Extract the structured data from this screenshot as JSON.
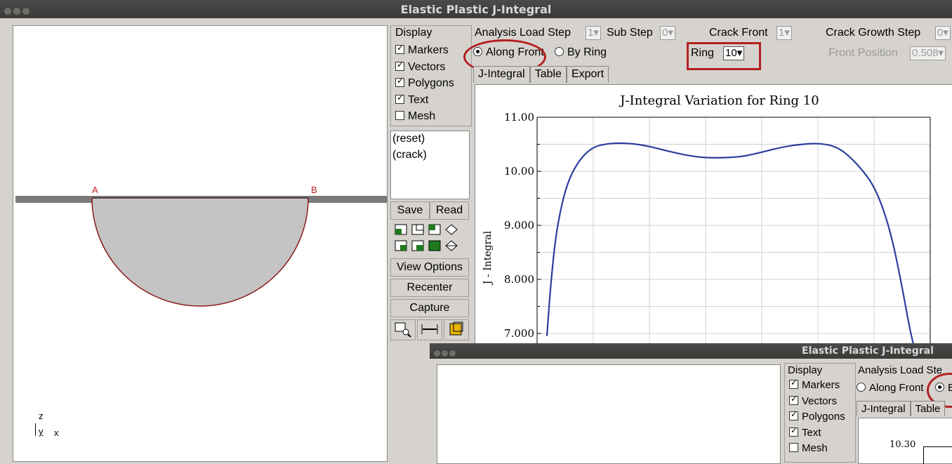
{
  "window": {
    "title": "Elastic Plastic J-Integral"
  },
  "display": {
    "heading": "Display",
    "checkboxes": [
      {
        "label": "Markers",
        "checked": true
      },
      {
        "label": "Vectors",
        "checked": true
      },
      {
        "label": "Polygons",
        "checked": true
      },
      {
        "label": "Text",
        "checked": true
      },
      {
        "label": "Mesh",
        "checked": false
      }
    ],
    "list_items": [
      "(reset)",
      "(crack)"
    ],
    "save_label": "Save",
    "read_label": "Read",
    "view_options_label": "View Options",
    "recenter_label": "Recenter",
    "capture_label": "Capture"
  },
  "viewport": {
    "marker_a": "A",
    "marker_b": "B",
    "axis_z": "z",
    "axis_y": "y",
    "axis_x": "x"
  },
  "controls": {
    "analysis_load_step_label": "Analysis Load Step",
    "analysis_load_step_value": "1",
    "sub_step_label": "Sub Step",
    "sub_step_value": "0",
    "crack_front_label": "Crack Front",
    "crack_front_value": "1",
    "crack_growth_step_label": "Crack Growth Step",
    "crack_growth_step_value": "0",
    "along_front_label": "Along Front",
    "by_ring_label": "By Ring",
    "selected_mode": "Along Front",
    "ring_label": "Ring",
    "ring_value": "10",
    "front_position_label": "Front Position",
    "front_position_value": "0.508"
  },
  "tabs": [
    "J-Integral",
    "Table",
    "Export"
  ],
  "colors": {
    "curve": "#2b3ea0",
    "annotation": "#b41f1f"
  },
  "chart_data": {
    "type": "line",
    "title": "J-Integral Variation for Ring 10",
    "ylabel": "J - Integral",
    "xlabel": "",
    "yticks": [
      "11.00",
      "10.00",
      "9.000",
      "8.000",
      "7.000"
    ],
    "ylim": [
      6.95,
      11.0
    ],
    "grid": true,
    "series": [
      {
        "x": [
          0.0,
          0.01,
          0.025,
          0.05,
          0.08,
          0.12,
          0.17,
          0.22,
          0.27,
          0.32,
          0.37,
          0.42,
          0.47,
          0.5,
          0.53,
          0.58,
          0.63,
          0.68,
          0.73,
          0.78,
          0.83,
          0.88,
          0.92,
          0.95,
          0.975,
          0.99,
          1.0
        ],
        "y": [
          6.95,
          7.9,
          8.9,
          9.7,
          10.15,
          10.45,
          10.52,
          10.52,
          10.47,
          10.38,
          10.3,
          10.25,
          10.25,
          10.26,
          10.28,
          10.36,
          10.45,
          10.5,
          10.52,
          10.45,
          10.15,
          9.7,
          8.9,
          7.9,
          6.95,
          6.6,
          6.5
        ]
      }
    ]
  },
  "second_window": {
    "title": "Elastic Plastic J-Integral",
    "display_heading": "Display",
    "checkboxes": [
      {
        "label": "Markers",
        "checked": true
      },
      {
        "label": "Vectors",
        "checked": true
      },
      {
        "label": "Polygons",
        "checked": true
      },
      {
        "label": "Text",
        "checked": true
      },
      {
        "label": "Mesh",
        "checked": false
      }
    ],
    "analysis_load_step_label": "Analysis Load Ste",
    "along_front_label": "Along Front",
    "by_ring_label": "B",
    "tabs": [
      "J-Integral",
      "Table"
    ],
    "ytick_top": "10.30"
  }
}
